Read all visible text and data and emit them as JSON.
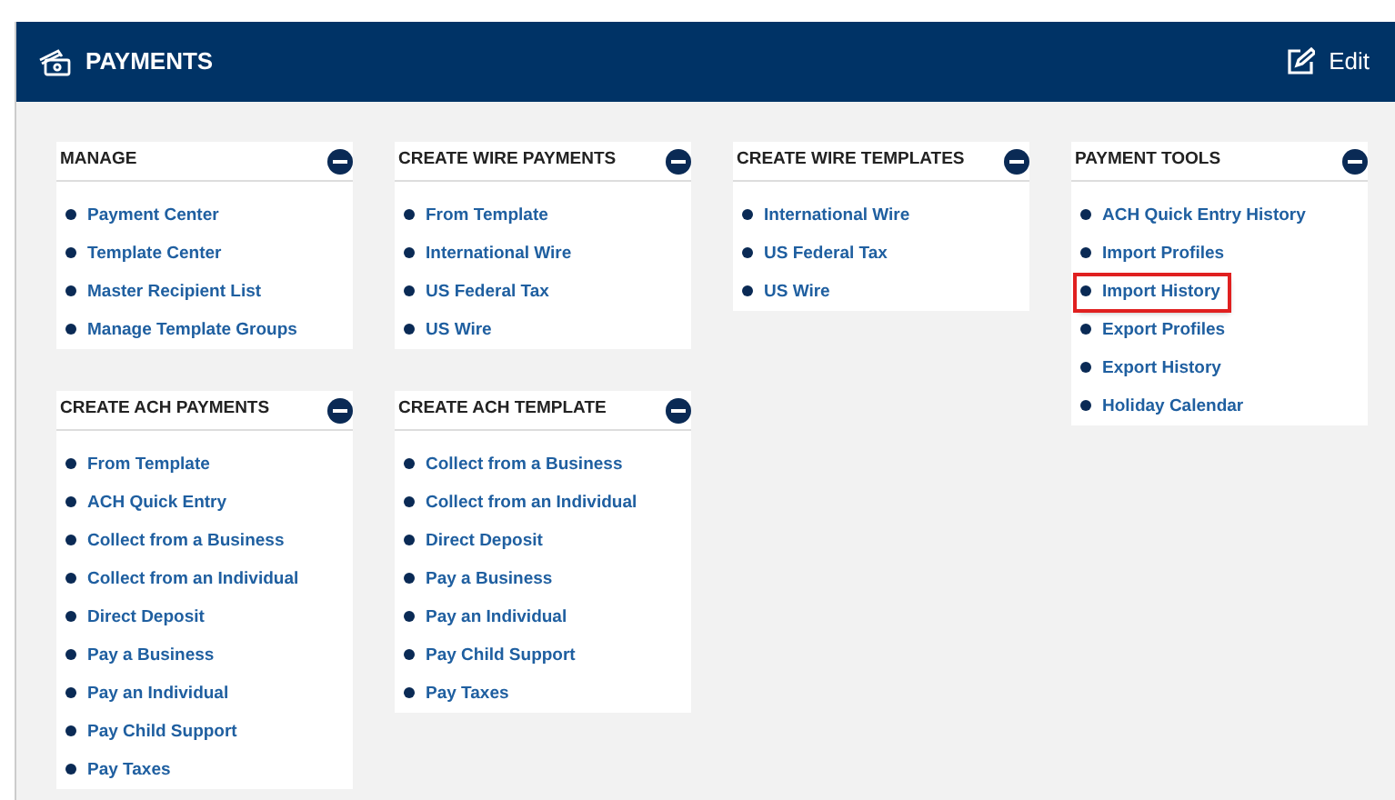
{
  "header": {
    "title": "PAYMENTS",
    "edit_label": "Edit"
  },
  "columns": [
    {
      "sections": [
        {
          "title": "MANAGE",
          "items": [
            {
              "label": "Payment Center",
              "highlighted": false
            },
            {
              "label": "Template Center",
              "highlighted": false
            },
            {
              "label": "Master Recipient List",
              "highlighted": false
            },
            {
              "label": "Manage Template Groups",
              "highlighted": false
            }
          ]
        },
        {
          "title": "CREATE ACH PAYMENTS",
          "items": [
            {
              "label": "From Template",
              "highlighted": false
            },
            {
              "label": "ACH Quick Entry",
              "highlighted": false
            },
            {
              "label": "Collect from a Business",
              "highlighted": false
            },
            {
              "label": "Collect from an Individual",
              "highlighted": false
            },
            {
              "label": "Direct Deposit",
              "highlighted": false
            },
            {
              "label": "Pay a Business",
              "highlighted": false
            },
            {
              "label": "Pay an Individual",
              "highlighted": false
            },
            {
              "label": "Pay Child Support",
              "highlighted": false
            },
            {
              "label": "Pay Taxes",
              "highlighted": false
            }
          ]
        }
      ]
    },
    {
      "sections": [
        {
          "title": "CREATE WIRE PAYMENTS",
          "items": [
            {
              "label": "From Template",
              "highlighted": false
            },
            {
              "label": "International Wire",
              "highlighted": false
            },
            {
              "label": "US Federal Tax",
              "highlighted": false
            },
            {
              "label": "US Wire",
              "highlighted": false
            }
          ]
        },
        {
          "title": "CREATE ACH TEMPLATE",
          "items": [
            {
              "label": "Collect from a Business",
              "highlighted": false
            },
            {
              "label": "Collect from an Individual",
              "highlighted": false
            },
            {
              "label": "Direct Deposit",
              "highlighted": false
            },
            {
              "label": "Pay a Business",
              "highlighted": false
            },
            {
              "label": "Pay an Individual",
              "highlighted": false
            },
            {
              "label": "Pay Child Support",
              "highlighted": false
            },
            {
              "label": "Pay Taxes",
              "highlighted": false
            }
          ]
        }
      ]
    },
    {
      "sections": [
        {
          "title": "CREATE WIRE TEMPLATES",
          "items": [
            {
              "label": "International Wire",
              "highlighted": false
            },
            {
              "label": "US Federal Tax",
              "highlighted": false
            },
            {
              "label": "US Wire",
              "highlighted": false
            }
          ]
        }
      ]
    },
    {
      "sections": [
        {
          "title": "PAYMENT TOOLS",
          "items": [
            {
              "label": "ACH Quick Entry History",
              "highlighted": false
            },
            {
              "label": "Import Profiles",
              "highlighted": false
            },
            {
              "label": "Import History",
              "highlighted": true
            },
            {
              "label": "Export Profiles",
              "highlighted": false
            },
            {
              "label": "Export History",
              "highlighted": false
            },
            {
              "label": "Holiday Calendar",
              "highlighted": false
            }
          ]
        }
      ]
    }
  ]
}
